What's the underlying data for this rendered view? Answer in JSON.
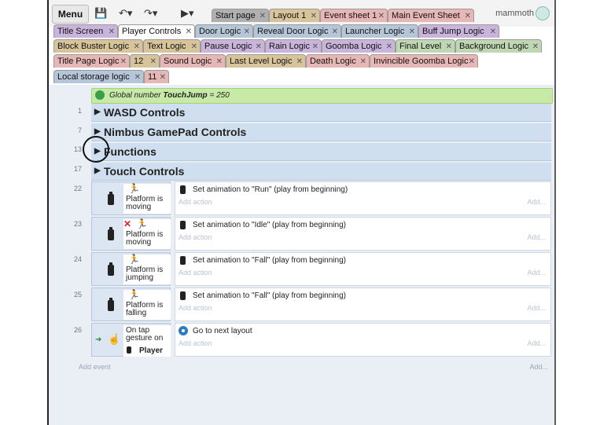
{
  "toolbar": {
    "menu_label": "Menu",
    "user_name": "mammoth"
  },
  "tabs_row1": [
    {
      "label": "Start page",
      "color": "#b0b0b0"
    },
    {
      "label": "Layout 1",
      "color": "#d7c49a"
    },
    {
      "label": "Event sheet 1",
      "color": "#e7b7b5"
    },
    {
      "label": "Main Event Sheet",
      "color": "#e7b7b5"
    }
  ],
  "tabs_row2": [
    {
      "label": "Title Screen",
      "color": "#c9b4dc"
    },
    {
      "label": "Player Controls",
      "color": "#ffffff",
      "active": true
    },
    {
      "label": "Door Logic",
      "color": "#b6c6d9"
    },
    {
      "label": "Reveal Door Logic",
      "color": "#b6c6d9"
    },
    {
      "label": "Launcher Logic",
      "color": "#b6c6d9"
    },
    {
      "label": "Buff Jump Logic",
      "color": "#c9b4dc"
    }
  ],
  "tabs_row3": [
    {
      "label": "Block Buster Logic",
      "color": "#d7c49a"
    },
    {
      "label": "Text Logic",
      "color": "#d7c49a"
    },
    {
      "label": "Pause Logic",
      "color": "#c9b4dc"
    },
    {
      "label": "Rain Logic",
      "color": "#c9b4dc"
    },
    {
      "label": "Goomba Logic",
      "color": "#c9b4dc"
    },
    {
      "label": "Final Level",
      "color": "#bfd7b3"
    },
    {
      "label": "Background Logic",
      "color": "#bfd7b3"
    }
  ],
  "tabs_row4": [
    {
      "label": "Title Page Logic",
      "color": "#e7b7b5"
    },
    {
      "label": "12",
      "color": "#d7c49a"
    },
    {
      "label": "Sound Logic",
      "color": "#e7b7b5"
    },
    {
      "label": "Last Level Logic",
      "color": "#d7c49a"
    },
    {
      "label": "Death Logic",
      "color": "#e7b7b5"
    },
    {
      "label": "Invincible Goomba Logic",
      "color": "#e7b7b5"
    }
  ],
  "tabs_row5": [
    {
      "label": "Local storage logic",
      "color": "#b6c6d9"
    },
    {
      "label": "11",
      "color": "#e7b7b5"
    }
  ],
  "sheet": {
    "global": {
      "prefix": "Global number",
      "name": "TouchJump",
      "value": "= 250"
    },
    "groups": [
      {
        "line": "1",
        "title": "WASD Controls"
      },
      {
        "line": "7",
        "title": "Nimbus GamePad Controls"
      },
      {
        "line": "13",
        "title": "Functions"
      },
      {
        "line": "17",
        "title": "Touch Controls"
      }
    ],
    "events": [
      {
        "line": "22",
        "cond": "Platform is moving",
        "negated": false,
        "action": "Set animation to \"Run\" (play from beginning)"
      },
      {
        "line": "23",
        "cond": "Platform is moving",
        "negated": true,
        "action": "Set animation to \"Idle\" (play from beginning)"
      },
      {
        "line": "24",
        "cond": "Platform is jumping",
        "negated": false,
        "action": "Set animation to \"Fall\" (play from beginning)"
      },
      {
        "line": "25",
        "cond": "Platform is falling",
        "negated": false,
        "action": "Set animation to \"Fall\" (play from beginning)"
      },
      {
        "line": "26",
        "cond": "On tap gesture on",
        "cond_object": "Player",
        "action": "Go to next layout"
      }
    ],
    "add_action_label": "Add action",
    "add_short": "Add...",
    "add_event_label": "Add event"
  }
}
